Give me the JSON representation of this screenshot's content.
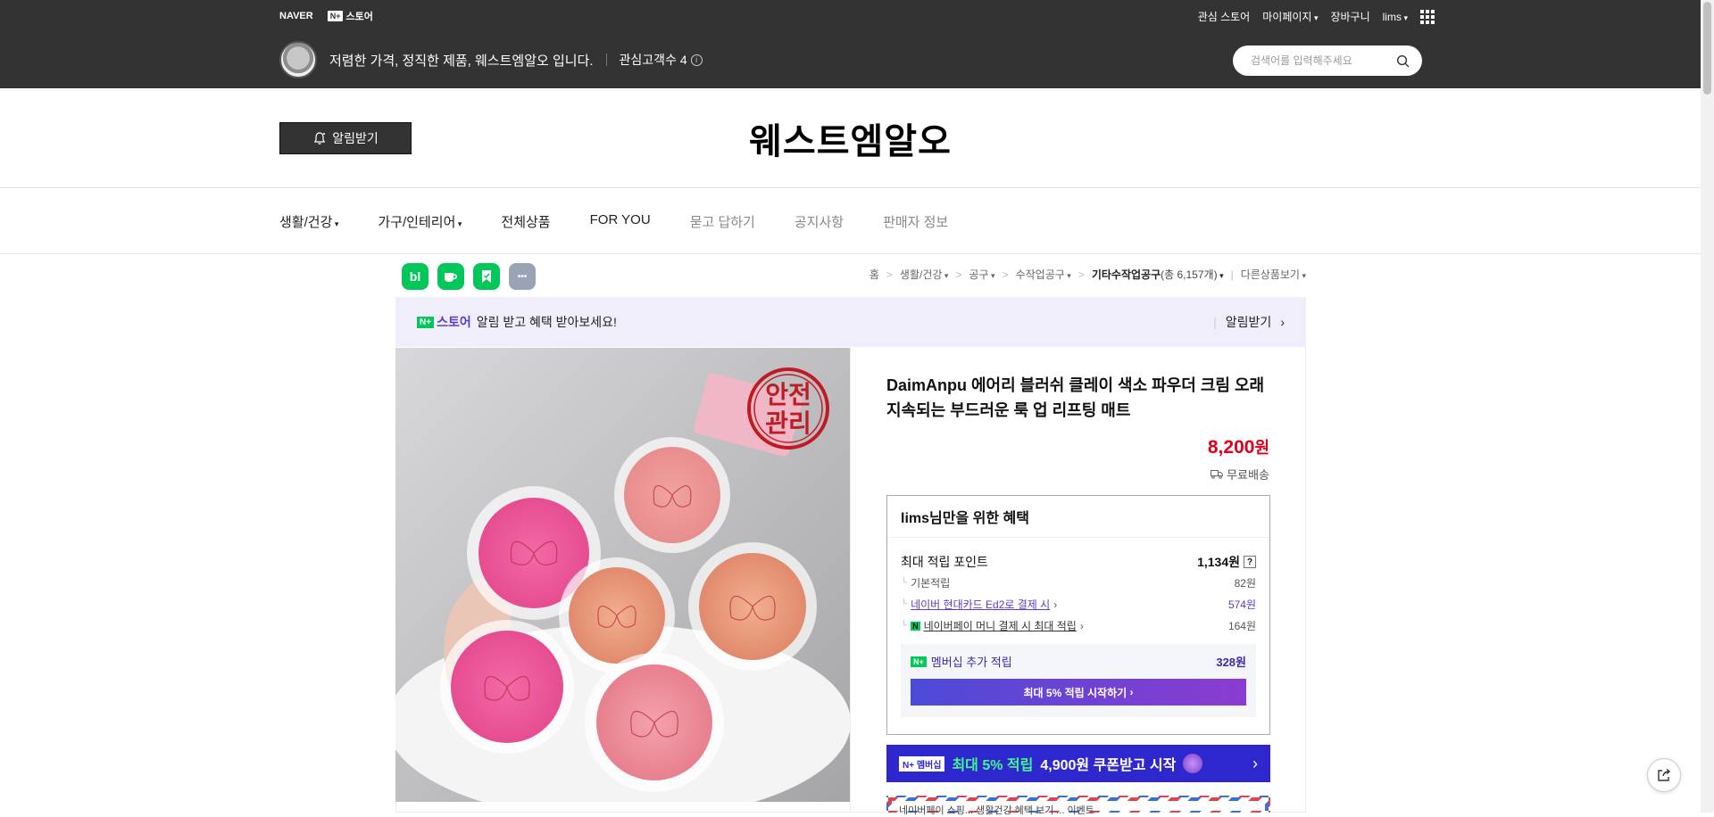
{
  "top": {
    "naver": "NAVER",
    "nplus_box": "N+",
    "nplus_store": "스토어",
    "links": [
      "관심 스토어",
      "마이페이지",
      "장바구니",
      "lims"
    ]
  },
  "store": {
    "description": "저렴한 가격, 정직한 제품, 웨스트엠알오 입니다.",
    "fans": "관심고객수 4",
    "search_placeholder": "검색어를 입력해주세요",
    "alarm_button": "알림받기",
    "title": "웨스트엠알오"
  },
  "categories": [
    {
      "label": "생활/건강",
      "dropdown": true
    },
    {
      "label": "가구/인테리어",
      "dropdown": true
    },
    {
      "label": "전체상품",
      "dropdown": false
    },
    {
      "label": "FOR YOU",
      "dropdown": false
    },
    {
      "label": "묻고 답하기",
      "dropdown": false
    },
    {
      "label": "공지사항",
      "dropdown": false
    },
    {
      "label": "판매자 정보",
      "dropdown": false
    }
  ],
  "share_icons": [
    {
      "name": "blog",
      "glyph": "bl",
      "color": "#03c75a"
    },
    {
      "name": "cafe",
      "glyph": "☕",
      "color": "#03c75a"
    },
    {
      "name": "bookmark",
      "glyph": "🔖",
      "color": "#03c75a"
    },
    {
      "name": "more",
      "glyph": "•••",
      "color": "#9aa3b5"
    }
  ],
  "breadcrumb": {
    "home": "홈",
    "c1": "생활/건강",
    "c2": "공구",
    "c3": "수작업공구",
    "c4": "기타수작업공구",
    "c4_count": "(총 6,157개)",
    "other": "다른상품보기"
  },
  "notice": {
    "n_box": "N+",
    "store": "스토어",
    "text": "알림 받고 혜택 받아보세요!",
    "action": "알림받기"
  },
  "product": {
    "image_stamp": "안전\n관리",
    "title": "DaimAnpu 에어리 블러쉬 클레이 색소 파우더 크림 오래 지속되는 부드러운 룩 업 리프팅 매트",
    "price": "8,200",
    "price_unit": "원",
    "shipping": "무료배송"
  },
  "benefit": {
    "header": "lims님만을 위한 혜택",
    "max_points_label": "최대 적립 포인트",
    "max_points_value": "1,134원",
    "basic_label": "기본적립",
    "basic_value": "82원",
    "card_label": "네이버 현대카드 Ed2로 결제 시",
    "card_value": "574원",
    "pay_label": "네이버페이 머니 결제 시 최대 적립",
    "pay_value": "164원",
    "member_label": "멤버십 추가 적립",
    "member_value": "328원",
    "member_button": "최대 5% 적립 시작하기"
  },
  "coupon_banner": {
    "badge": "N+ 멤버십",
    "highlight": "최대 5% 적립",
    "text": "4,900원 쿠폰받고 시작"
  },
  "airmail_text": "네이버페이 쇼핑... 생활건강 혜택 보기 ... 이벤트"
}
